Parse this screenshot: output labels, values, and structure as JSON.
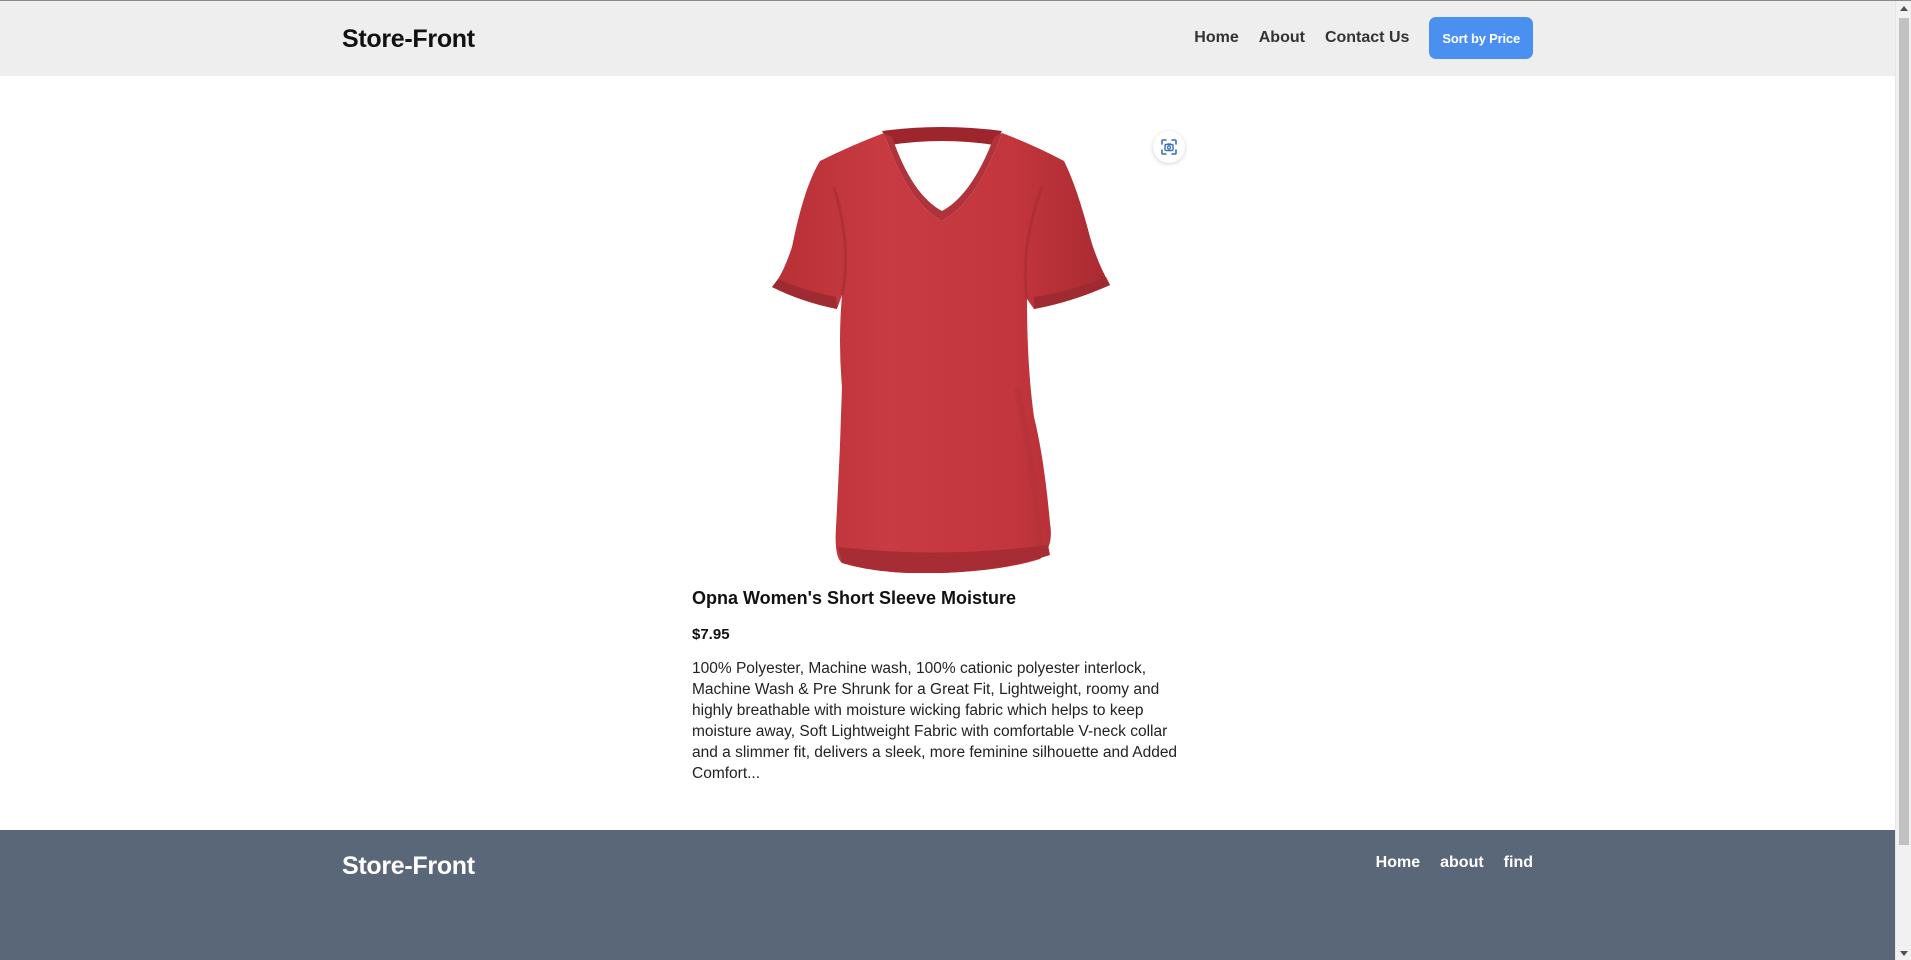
{
  "header": {
    "brand": "Store-Front",
    "nav": [
      "Home",
      "About",
      "Contact Us"
    ],
    "sort_button": "Sort by Price"
  },
  "product": {
    "title": "Opna Women's Short Sleeve Moisture",
    "price": "$7.95",
    "description": "100% Polyester, Machine wash, 100% cationic polyester interlock, Machine Wash & Pre Shrunk for a Great Fit, Lightweight, roomy and highly breathable with moisture wicking fabric which helps to keep moisture away, Soft Lightweight Fabric with comfortable V-neck collar and a slimmer fit, delivers a sleek, more feminine silhouette and Added Comfort...",
    "image_icon": "red-vneck-tshirt",
    "color": "#c8393f"
  },
  "footer": {
    "brand": "Store-Front",
    "links": [
      "Home",
      "about",
      "find"
    ]
  },
  "colors": {
    "header_bg": "#eeeeee",
    "accent": "#4a90f0",
    "footer_bg": "#5a6778"
  }
}
